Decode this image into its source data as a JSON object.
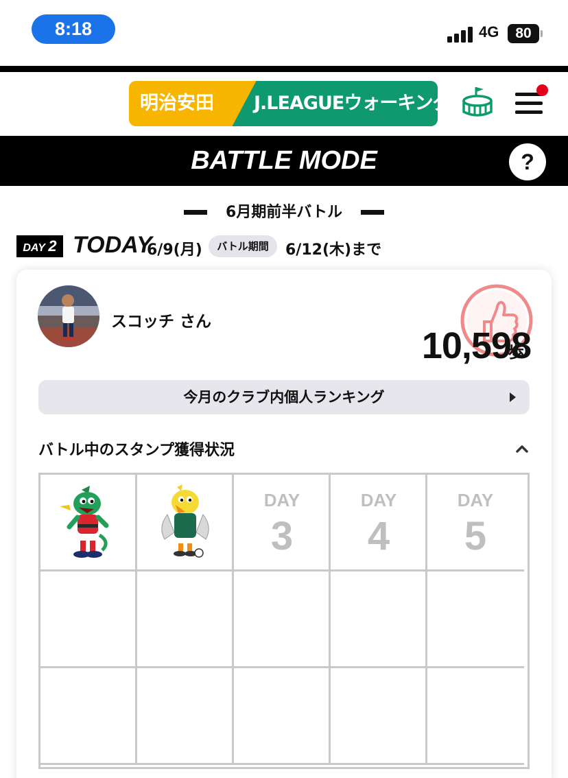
{
  "status_bar": {
    "time": "8:18",
    "network": "4G",
    "battery": "80"
  },
  "header": {
    "logo_part1": "明治安田",
    "logo_part2": "J.LEAGUEウォーキング",
    "colors": {
      "yellow": "#f7b500",
      "green": "#0e9a6e",
      "notification_dot": "#e4001b"
    }
  },
  "battle": {
    "title": "BATTLE MODE",
    "help_label": "?"
  },
  "period": {
    "label": "6月期前半バトル"
  },
  "day": {
    "badge_prefix": "DAY",
    "badge_number": "2",
    "today_label": "TODAY",
    "today_date": "6/9(月)",
    "period_chip": "バトル期間",
    "until": "6/12(木)まで"
  },
  "user": {
    "name": "スコッチ さん",
    "steps": "10,598",
    "steps_unit": "歩"
  },
  "ranking": {
    "label": "今月のクラブ内個人ランキング"
  },
  "stamps": {
    "title": "バトル中のスタンプ獲得状況",
    "day_cells": [
      {
        "label": "DAY",
        "number": "3"
      },
      {
        "label": "DAY",
        "number": "4"
      },
      {
        "label": "DAY",
        "number": "5"
      }
    ],
    "earned_icons": [
      "green-dragon-mascot-icon",
      "yellow-bird-mascot-icon"
    ]
  }
}
